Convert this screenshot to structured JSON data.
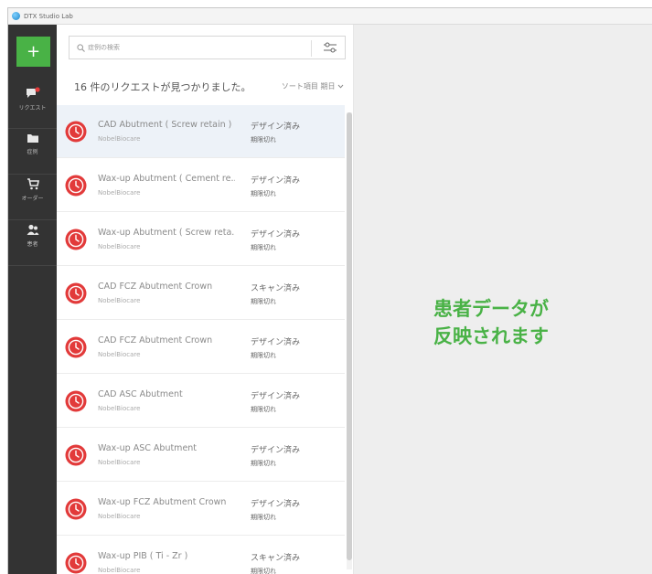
{
  "window": {
    "title": "DTX Studio Lab"
  },
  "sidebar": {
    "add_label": "+",
    "items": [
      {
        "label": "リクエスト",
        "icon": "chat-notification-icon"
      },
      {
        "label": "症例",
        "icon": "folder-icon"
      },
      {
        "label": "オーダー",
        "icon": "cart-icon"
      },
      {
        "label": "患者",
        "icon": "patients-icon"
      }
    ]
  },
  "search": {
    "placeholder": "症例の検索",
    "filter_icon": "filter-sliders-icon"
  },
  "results": {
    "count_text": "16 件のリクエストが見つかりました。",
    "sort_label": "ソート項目 期日",
    "sort_icon": "chevron-down-icon"
  },
  "requests": [
    {
      "title": "CAD Abutment ( Screw retain )",
      "company": "NobelBiocare",
      "status": "デザイン済み",
      "expiry": "期限切れ",
      "icon": "clock-icon",
      "selected": true
    },
    {
      "title": "Wax-up Abutment ( Cement re...",
      "company": "NobelBiocare",
      "status": "デザイン済み",
      "expiry": "期限切れ",
      "icon": "clock-icon"
    },
    {
      "title": "Wax-up Abutment ( Screw reta...",
      "company": "NobelBiocare",
      "status": "デザイン済み",
      "expiry": "期限切れ",
      "icon": "clock-icon"
    },
    {
      "title": "CAD FCZ Abutment Crown",
      "company": "NobelBiocare",
      "status": "スキャン済み",
      "expiry": "期限切れ",
      "icon": "clock-icon"
    },
    {
      "title": "CAD FCZ Abutment Crown",
      "company": "NobelBiocare",
      "status": "デザイン済み",
      "expiry": "期限切れ",
      "icon": "clock-icon"
    },
    {
      "title": "CAD ASC Abutment",
      "company": "NobelBiocare",
      "status": "デザイン済み",
      "expiry": "期限切れ",
      "icon": "clock-icon"
    },
    {
      "title": "Wax-up ASC Abutment",
      "company": "NobelBiocare",
      "status": "デザイン済み",
      "expiry": "期限切れ",
      "icon": "clock-icon"
    },
    {
      "title": "Wax-up FCZ Abutment Crown",
      "company": "NobelBiocare",
      "status": "デザイン済み",
      "expiry": "期限切れ",
      "icon": "clock-icon"
    },
    {
      "title": "Wax-up PIB ( Ti - Zr )",
      "company": "NobelBiocare",
      "status": "スキャン済み",
      "expiry": "期限切れ",
      "icon": "clock-icon"
    }
  ],
  "detail": {
    "line1": "患者データが",
    "line2": "反映されます"
  },
  "colors": {
    "accent_green": "#49b246",
    "sidebar_bg": "#333333",
    "clock_red": "#e23a3a",
    "selected_row": "#edf2f8"
  }
}
